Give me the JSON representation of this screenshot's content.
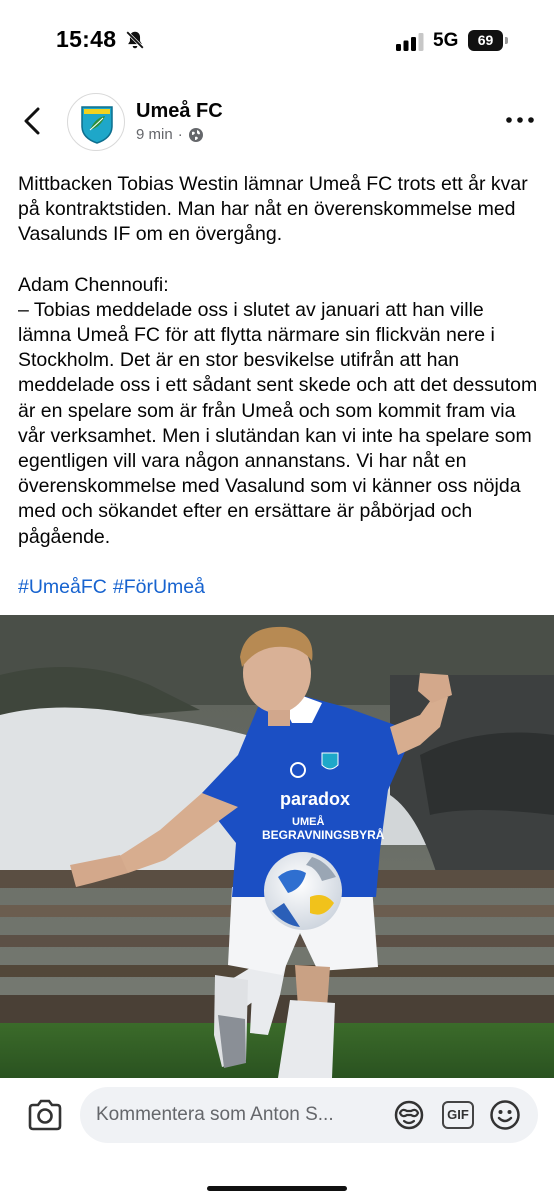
{
  "status_bar": {
    "time": "15:48",
    "network": "5G",
    "battery": "69",
    "icons": [
      "bell-slash-icon",
      "signal-bars-icon"
    ]
  },
  "post": {
    "page_name": "Umeå FC",
    "time_ago": "9 min",
    "separator": "·",
    "paragraphs": [
      "Mittbacken Tobias Westin lämnar Umeå FC trots ett år kvar på kontraktstiden. Man har nåt en överenskommelse med Vasalunds IF om en övergång.",
      "Adam Chennoufi:",
      "– Tobias meddelade oss i slutet av januari att han ville lämna Umeå FC för att flytta närmare sin flickvän nere i Stockholm. Det är en stor besvikelse utifrån att han meddelade oss i ett sådant sent skede och att det dessutom är en spelare som är från Umeå och som kommit fram via vår verksamhet. Men i slutändan kan vi inte ha spelare som egentligen vill vara någon annanstans. Vi har nåt en överenskommelse med Vasalund som vi känner oss nöjda med och sökandet efter en ersättare är påbörjad och pågående."
    ],
    "hashtags": [
      "#UmeåFC",
      "#FörUmeå"
    ],
    "photo_text": {
      "shirt_sponsor": "paradox",
      "shirt_sponsor_2": "UMEÅ",
      "shirt_sponsor_3": "BEGRAVNINGSBYRÅ"
    }
  },
  "comment_bar": {
    "placeholder": "Kommentera som Anton S...",
    "gif_label": "GIF"
  },
  "colors": {
    "link": "#1763cf",
    "meta": "#65676b",
    "input_bg": "#f0f2f5",
    "shirt_blue": "#1b4fc4"
  }
}
